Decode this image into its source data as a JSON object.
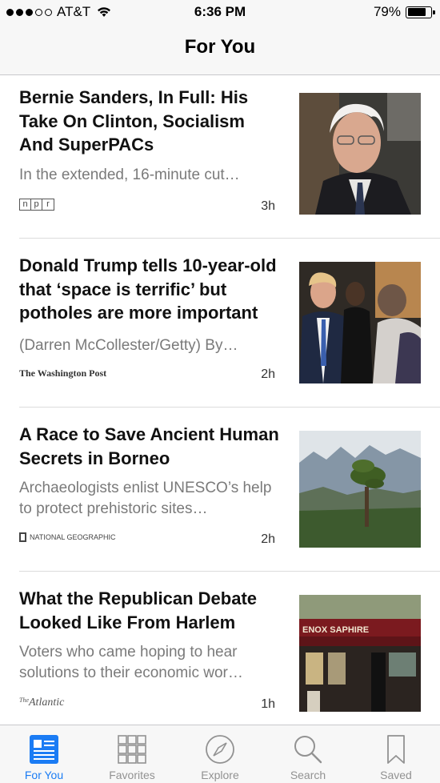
{
  "status_bar": {
    "carrier": "AT&T",
    "time": "6:36 PM",
    "battery_percent": "79%",
    "battery_level": 0.79,
    "signal_bars_filled": 3,
    "signal_bars_total": 5
  },
  "nav": {
    "title": "For You"
  },
  "articles": [
    {
      "headline": "Bernie Sanders, In Full: His Take On Clinton, Socialism And SuperPACs",
      "summary": "In the extended, 16-minute cut…",
      "source": "npr",
      "source_letters": [
        "n",
        "p",
        "r"
      ],
      "age": "3h"
    },
    {
      "headline": "Donald Trump tells 10-year-old that ‘space is terrific’ but potholes are more important",
      "summary": "(Darren McCollester/Getty) By…",
      "source": "The Washington Post",
      "age": "2h"
    },
    {
      "headline": "A Race to Save Ancient Human Secrets in Borneo",
      "summary": "Archaeologists enlist UNESCO’s help to protect prehistoric sites…",
      "source": "NATIONAL GEOGRAPHIC",
      "age": "2h"
    },
    {
      "headline": "What the Republican Debate Looked Like From Harlem",
      "summary": "Voters who came hoping to hear solutions to their economic wor…",
      "source": "Atlantic",
      "source_prefix": "The",
      "storefront_sign": "ENOX SAPHIRE",
      "age": "1h"
    }
  ],
  "tabs": [
    {
      "label": "For You",
      "icon": "news-icon",
      "active": true
    },
    {
      "label": "Favorites",
      "icon": "grid-icon",
      "active": false
    },
    {
      "label": "Explore",
      "icon": "compass-icon",
      "active": false
    },
    {
      "label": "Search",
      "icon": "search-icon",
      "active": false
    },
    {
      "label": "Saved",
      "icon": "bookmark-icon",
      "active": false
    }
  ],
  "colors": {
    "accent": "#1b7cf4",
    "inactive": "#929292"
  }
}
